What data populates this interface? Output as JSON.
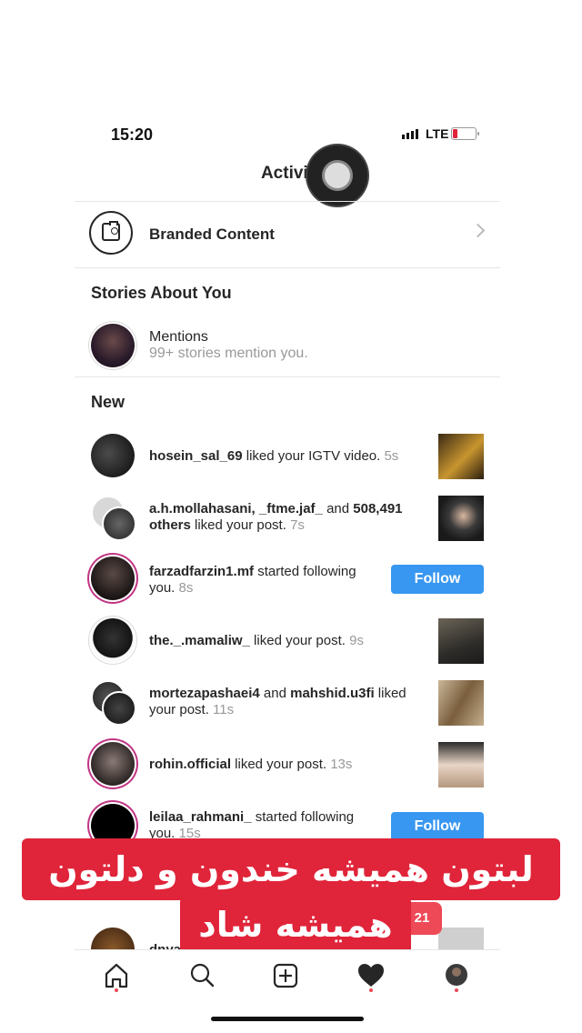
{
  "status": {
    "time": "15:20",
    "network": "LTE"
  },
  "header": {
    "title": "Activit"
  },
  "branded": {
    "label": "Branded Content",
    "icon": "branded-content-icon"
  },
  "stories": {
    "heading": "Stories About You",
    "mentions_title": "Mentions",
    "mentions_sub": "99+ stories mention you."
  },
  "new_heading": "New",
  "activity": [
    {
      "user": "hosein_sal_69",
      "action": " liked your IGTV video. ",
      "time": "5s"
    },
    {
      "user": "a.h.mollahasani, _ftme.jaf_",
      "mid": " and ",
      "count": "508,491 others",
      "action": " liked your post. ",
      "time": "7s"
    },
    {
      "user": "farzadfarzin1.mf",
      "action": " started following you. ",
      "time": "8s",
      "button": "Follow"
    },
    {
      "user": "the._.mamaliw_",
      "action": " liked your post. ",
      "time": "9s"
    },
    {
      "user": "mortezapashaei4",
      "mid": " and ",
      "user2": "mahshid.u3fi",
      "action": " liked your post. ",
      "time": "11s"
    },
    {
      "user": "rohin.official",
      "action": " liked your post. ",
      "time": "13s"
    },
    {
      "user": "leilaa_rahmani_",
      "action": " started following you. ",
      "time": "15s",
      "button": "Follow"
    },
    {
      "user": "dnya",
      "action": "",
      "time": ""
    }
  ],
  "overlay": {
    "line1": "لبتون همیشه خندون و دلتون",
    "line2": "همیشه شاد",
    "badge": "21"
  },
  "colors": {
    "accent": "#3897f0",
    "overlay": "#e0243a",
    "notification": "#ed4956"
  },
  "tabbar": [
    "home-icon",
    "search-icon",
    "add-post-icon",
    "heart-icon",
    "profile-icon"
  ]
}
